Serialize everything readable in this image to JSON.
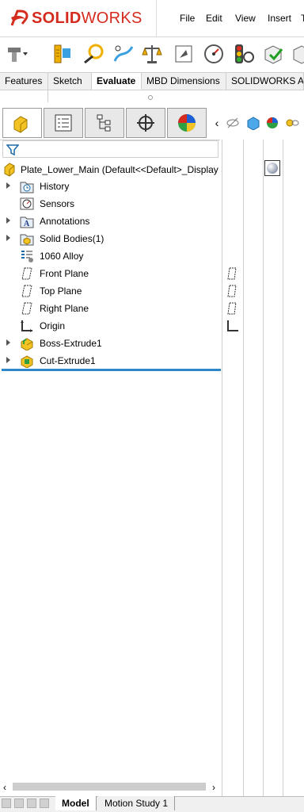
{
  "app": {
    "brand_ds": "DS",
    "brand_solid": "SOLID",
    "brand_works": "WORKS"
  },
  "menu": [
    "File",
    "Edit",
    "View",
    "Insert",
    "T"
  ],
  "command_icons": [
    "design-checker-icon",
    "measure-icon",
    "markup-icon",
    "mass-properties-icon",
    "section-properties-icon",
    "sensor-icon",
    "performance-evaluation-icon",
    "check-icon",
    "geometry-analysis-icon"
  ],
  "tabs": [
    "Features",
    "Sketch",
    "Evaluate",
    "MBD Dimensions",
    "SOLIDWORKS Ad"
  ],
  "active_tab": "Evaluate",
  "manager_tabs": [
    "feature-manager-icon",
    "property-manager-icon",
    "configuration-manager-icon",
    "dimxpert-manager-icon",
    "display-manager-icon"
  ],
  "tree": {
    "root": "Plate_Lower_Main  (Default<<Default>_Display S",
    "items": [
      {
        "label": "History",
        "icon": "history-folder-icon",
        "expandable": true
      },
      {
        "label": "Sensors",
        "icon": "sensors-icon",
        "expandable": false
      },
      {
        "label": "Annotations",
        "icon": "annotations-icon",
        "expandable": true
      },
      {
        "label": "Solid Bodies(1)",
        "icon": "solid-bodies-icon",
        "expandable": true
      },
      {
        "label": "1060 Alloy",
        "icon": "material-icon",
        "expandable": false
      },
      {
        "label": "Front Plane",
        "icon": "plane-icon",
        "expandable": false
      },
      {
        "label": "Top Plane",
        "icon": "plane-icon",
        "expandable": false
      },
      {
        "label": "Right Plane",
        "icon": "plane-icon",
        "expandable": false
      },
      {
        "label": "Origin",
        "icon": "origin-icon",
        "expandable": false
      },
      {
        "label": "Boss-Extrude1",
        "icon": "boss-extrude-icon",
        "expandable": true
      },
      {
        "label": "Cut-Extrude1",
        "icon": "cut-extrude-icon",
        "expandable": true
      }
    ]
  },
  "bottom_tabs": [
    "Model",
    "Motion Study 1"
  ],
  "colors": {
    "brand": "#d52b1e",
    "rollback": "#2d87c8",
    "tab_bg": "#f0f0f0"
  }
}
